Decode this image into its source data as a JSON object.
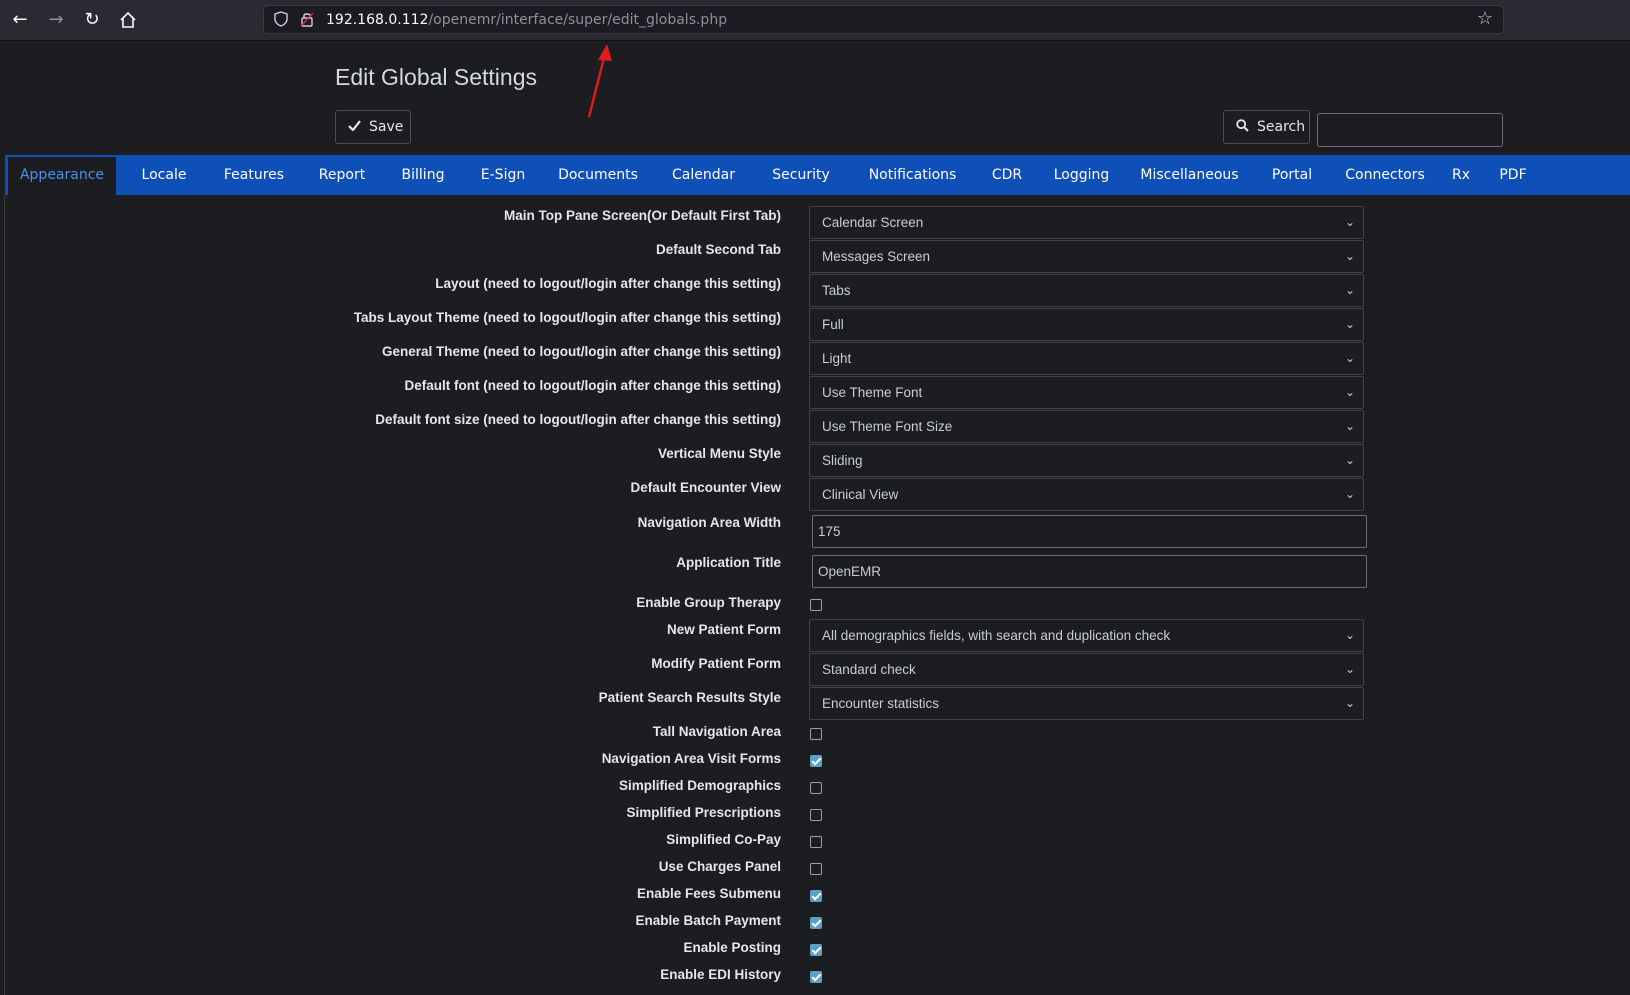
{
  "browser": {
    "url_host": "192.168.0.112",
    "url_path": "/openemr/interface/super/edit_globals.php"
  },
  "page": {
    "title": "Edit Global Settings",
    "save_label": "Save",
    "search_label": "Search",
    "search_value": ""
  },
  "tabs": [
    "Appearance",
    "Locale",
    "Features",
    "Report",
    "Billing",
    "E-Sign",
    "Documents",
    "Calendar",
    "Security",
    "Notifications",
    "CDR",
    "Logging",
    "Miscellaneous",
    "Portal",
    "Connectors",
    "Rx",
    "PDF"
  ],
  "settings": {
    "main_top_pane": {
      "label": "Main Top Pane Screen(Or Default First Tab)",
      "value": "Calendar Screen"
    },
    "default_second_tab": {
      "label": "Default Second Tab",
      "value": "Messages Screen"
    },
    "layout": {
      "label": "Layout (need to logout/login after change this setting)",
      "value": "Tabs"
    },
    "tabs_layout_theme": {
      "label": "Tabs Layout Theme (need to logout/login after change this setting)",
      "value": "Full"
    },
    "general_theme": {
      "label": "General Theme (need to logout/login after change this setting)",
      "value": "Light"
    },
    "default_font": {
      "label": "Default font (need to logout/login after change this setting)",
      "value": "Use Theme Font"
    },
    "default_font_size": {
      "label": "Default font size (need to logout/login after change this setting)",
      "value": "Use Theme Font Size"
    },
    "vertical_menu_style": {
      "label": "Vertical Menu Style",
      "value": "Sliding"
    },
    "default_encounter_view": {
      "label": "Default Encounter View",
      "value": "Clinical View"
    },
    "navigation_area_width": {
      "label": "Navigation Area Width",
      "value": "175"
    },
    "application_title": {
      "label": "Application Title",
      "value": "OpenEMR"
    },
    "enable_group_therapy": {
      "label": "Enable Group Therapy",
      "checked": false
    },
    "new_patient_form": {
      "label": "New Patient Form",
      "value": "All demographics fields, with search and duplication check"
    },
    "modify_patient_form": {
      "label": "Modify Patient Form",
      "value": "Standard check"
    },
    "patient_search_results_style": {
      "label": "Patient Search Results Style",
      "value": "Encounter statistics"
    },
    "tall_navigation_area": {
      "label": "Tall Navigation Area",
      "checked": false
    },
    "navigation_area_visit_forms": {
      "label": "Navigation Area Visit Forms",
      "checked": true
    },
    "simplified_demographics": {
      "label": "Simplified Demographics",
      "checked": false
    },
    "simplified_prescriptions": {
      "label": "Simplified Prescriptions",
      "checked": false
    },
    "simplified_copay": {
      "label": "Simplified Co-Pay",
      "checked": false
    },
    "use_charges_panel": {
      "label": "Use Charges Panel",
      "checked": false
    },
    "enable_fees_submenu": {
      "label": "Enable Fees Submenu",
      "checked": true
    },
    "enable_batch_payment": {
      "label": "Enable Batch Payment",
      "checked": true
    },
    "enable_posting": {
      "label": "Enable Posting",
      "checked": true
    },
    "enable_edi_history": {
      "label": "Enable EDI History",
      "checked": true
    }
  },
  "icons": {
    "back": "arrow-left-icon",
    "forward": "arrow-right-icon",
    "reload": "reload-icon",
    "home": "home-icon",
    "shield": "shield-icon",
    "insecure": "lock-insecure-icon",
    "bookmark": "star-icon",
    "save": "check-icon",
    "search": "magnifier-icon",
    "dropdown": "chevron-down-icon"
  },
  "colors": {
    "accent": "#0f4fb8",
    "active_tab_text": "#4a90f0",
    "background": "#1b1d21",
    "checkbox_checked": "#5aa0c8",
    "annotation_arrow": "#e01b1b"
  }
}
